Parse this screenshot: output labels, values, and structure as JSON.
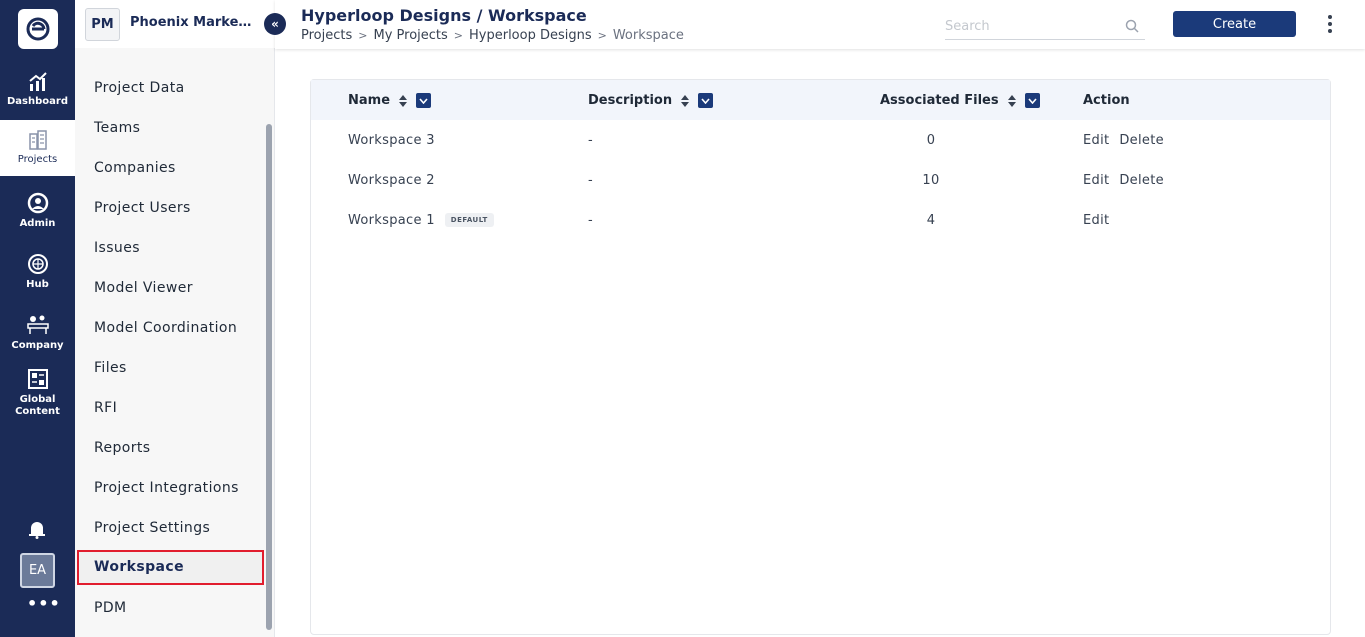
{
  "rail": {
    "items": [
      {
        "label": "Dashboard",
        "icon": "chart-up-icon"
      },
      {
        "label": "Projects",
        "icon": "buildings-icon"
      },
      {
        "label": "Admin",
        "icon": "user-circle-icon"
      },
      {
        "label": "Hub",
        "icon": "globe-icon"
      },
      {
        "label": "Company",
        "icon": "people-desk-icon"
      },
      {
        "label": "Global Content",
        "icon": "grid-content-icon"
      }
    ],
    "avatar": "EA",
    "more": "•••"
  },
  "sidebar": {
    "project_initials": "PM",
    "project_name": "Phoenix Marke…",
    "items": [
      {
        "label": "Project Data"
      },
      {
        "label": "Teams"
      },
      {
        "label": "Companies"
      },
      {
        "label": "Project Users"
      },
      {
        "label": "Issues"
      },
      {
        "label": "Model Viewer"
      },
      {
        "label": "Model Coordination"
      },
      {
        "label": "Files"
      },
      {
        "label": "RFI"
      },
      {
        "label": "Reports"
      },
      {
        "label": "Project Integrations"
      },
      {
        "label": "Project Settings"
      },
      {
        "label": "Workspace"
      },
      {
        "label": "PDM"
      }
    ]
  },
  "header": {
    "title": "Hyperloop Designs / Workspace",
    "breadcrumbs": [
      "Projects",
      "My Projects",
      "Hyperloop Designs",
      "Workspace"
    ],
    "search_placeholder": "Search",
    "create_label": "Create"
  },
  "table": {
    "columns": [
      "Name",
      "Description",
      "Associated Files",
      "Action"
    ],
    "rows": [
      {
        "name": "Workspace 3",
        "badge": "",
        "description": "-",
        "files": "0",
        "actions": [
          "Edit",
          "Delete"
        ]
      },
      {
        "name": "Workspace 2",
        "badge": "",
        "description": "-",
        "files": "10",
        "actions": [
          "Edit",
          "Delete"
        ]
      },
      {
        "name": "Workspace 1",
        "badge": "DEFAULT",
        "description": "-",
        "files": "4",
        "actions": [
          "Edit"
        ]
      }
    ]
  },
  "colors": {
    "navy": "#1b2b57",
    "button": "#1b3a7a",
    "active_outline": "#e11d2e",
    "table_header_bg": "#f2f5fb"
  }
}
